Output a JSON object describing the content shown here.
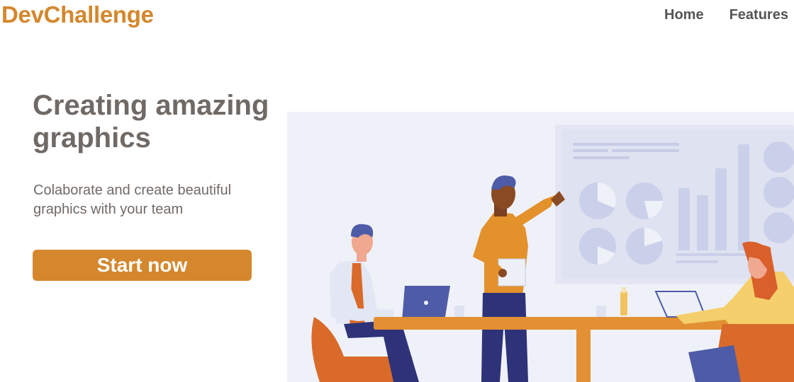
{
  "brand": {
    "name": "DevChallenge"
  },
  "nav": {
    "items": [
      {
        "label": "Home"
      },
      {
        "label": "Features"
      }
    ]
  },
  "hero": {
    "title": "Creating amazing graphics",
    "subtitle": "Colaborate and create beautiful graphics with your team",
    "cta_label": "Start now"
  },
  "illustration": {
    "name": "team-meeting-illustration"
  },
  "colors": {
    "accent": "#d4872d",
    "heading": "#706a66",
    "nav_text": "#555555",
    "illustration_bg": "#eff1f9",
    "presentation_board": "#dfe2f0",
    "table": "#e29033",
    "chair": "#d96a2a",
    "trousers": "#2e3279",
    "shirt_orange": "#e3912b",
    "shirt_yellow": "#f4cf6b",
    "hair_blue": "#4e5ba6",
    "hair_red": "#d95f2b"
  }
}
